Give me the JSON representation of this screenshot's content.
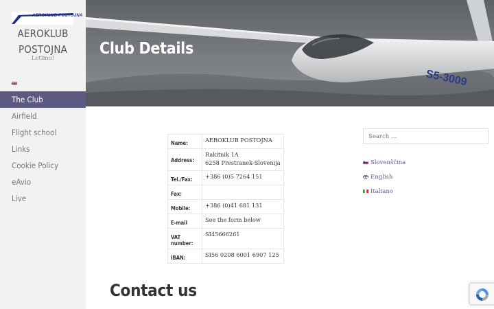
{
  "sidebar": {
    "logo_text": "AEROKLUB POSTOJNA",
    "title_line1": "AEROKLUB",
    "title_line2": "POSTOJNA",
    "tagline": "Letimo!",
    "nav": [
      {
        "label": "The Club"
      },
      {
        "label": "Airfield"
      },
      {
        "label": "Flight school"
      },
      {
        "label": "Links"
      },
      {
        "label": "Cookie Policy"
      },
      {
        "label": "eAvio"
      },
      {
        "label": "Live"
      }
    ]
  },
  "hero": {
    "title": "Club Details",
    "glider_registration": "S5-3009"
  },
  "details": {
    "rows": [
      {
        "key": "Name:",
        "value": "AEROKLUB POSTOJNA"
      },
      {
        "key": "Address:",
        "value": "Rakitnik 1A",
        "value2": "6258 Prestranek-Slovenija"
      },
      {
        "key": "Tel./Fax:",
        "value": "+386 (0)5 7264 151"
      },
      {
        "key": "Fax:",
        "value": ""
      },
      {
        "key": "Mobile:",
        "value": "+386 (0)41 681 131"
      },
      {
        "key": "E-mail",
        "value": "See the form below"
      },
      {
        "key": "VAT number:",
        "value": "SI45666261"
      },
      {
        "key": "IBAN:",
        "value": "SI56 0208 6001 6907 125"
      }
    ]
  },
  "search": {
    "placeholder": "Search …"
  },
  "languages": [
    {
      "label": "Slovenščina"
    },
    {
      "label": "English"
    },
    {
      "label": "Italiano"
    }
  ],
  "contact": {
    "title": "Contact us"
  },
  "colors": {
    "accent": "#5d5a82",
    "sidebar_bg": "#f2f2f2"
  }
}
